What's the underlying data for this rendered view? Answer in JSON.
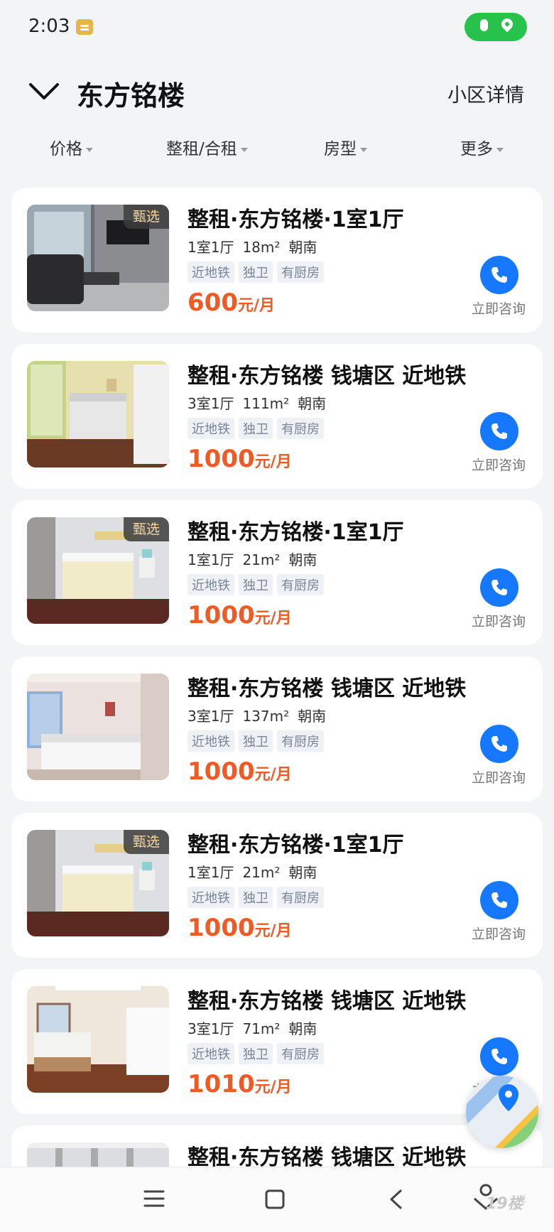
{
  "status_bar": {
    "time": "2:03"
  },
  "header": {
    "title": "东方铭楼",
    "detail_link": "小区详情"
  },
  "filters": [
    "价格",
    "整租/合租",
    "房型",
    "更多"
  ],
  "listing_common": {
    "tags": [
      "近地铁",
      "独卫",
      "有厨房"
    ],
    "price_unit": "元/月",
    "call_label": "立即咨询",
    "badge_label": "甄选"
  },
  "listings": [
    {
      "title": "整租·东方铭楼·1室1厅",
      "layout": "1室1厅",
      "area": "18m²",
      "orientation": "朝南",
      "price": "600",
      "badge": true,
      "photo": "living-room"
    },
    {
      "title": "整租·东方铭楼 钱塘区 近地铁",
      "layout": "3室1厅",
      "area": "111m²",
      "orientation": "朝南",
      "price": "1000",
      "badge": false,
      "photo": "bedroom-balcony"
    },
    {
      "title": "整租·东方铭楼·1室1厅",
      "layout": "1室1厅",
      "area": "21m²",
      "orientation": "朝南",
      "price": "1000",
      "badge": true,
      "photo": "bedroom-curtain"
    },
    {
      "title": "整租·东方铭楼 钱塘区 近地铁",
      "layout": "3室1厅",
      "area": "137m²",
      "orientation": "朝南",
      "price": "1000",
      "badge": false,
      "photo": "bedroom-pink"
    },
    {
      "title": "整租·东方铭楼·1室1厅",
      "layout": "1室1厅",
      "area": "21m²",
      "orientation": "朝南",
      "price": "1000",
      "badge": true,
      "photo": "bedroom-curtain"
    },
    {
      "title": "整租·东方铭楼 钱塘区 近地铁",
      "layout": "3室1厅",
      "area": "71m²",
      "orientation": "朝南",
      "price": "1010",
      "badge": false,
      "photo": "bedroom-wood"
    },
    {
      "title": "整租·东方铭楼 钱塘区 近地铁",
      "layout": "",
      "area": "",
      "orientation": "",
      "price": "",
      "badge": false,
      "photo": "room-light"
    }
  ],
  "watermark": "19楼",
  "colors": {
    "accent": "#1677ff",
    "price": "#f05a24",
    "status_green": "#27c24c"
  }
}
